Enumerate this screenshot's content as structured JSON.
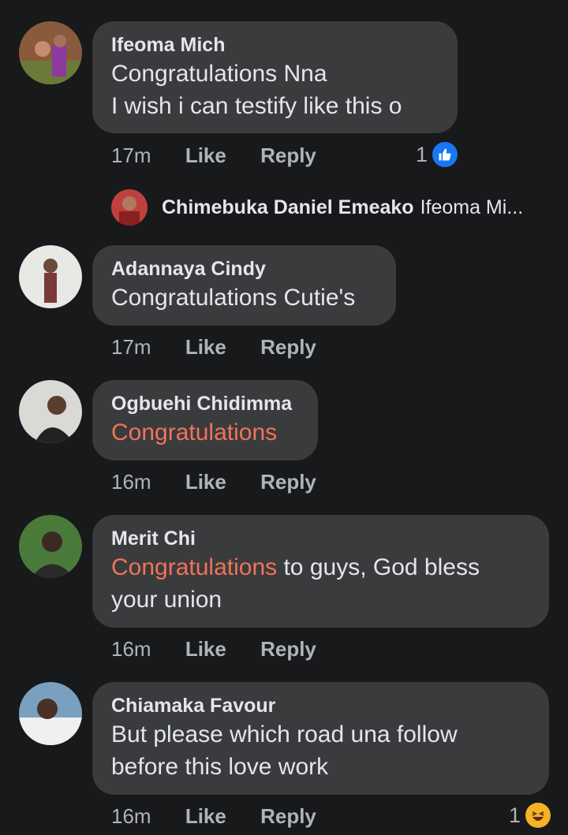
{
  "thread": {
    "comments": [
      {
        "name": "Ifeoma Mich",
        "lines": [
          "Congratulations Nna",
          "I wish i can testify like this o"
        ],
        "time": "17m",
        "like": "Like",
        "reply": "Reply",
        "reaction_count": "1",
        "reaction_icon": "like-icon"
      },
      {
        "name": "Adannaya Cindy",
        "lines": [
          "Congratulations Cutie's"
        ],
        "time": "17m",
        "like": "Like",
        "reply": "Reply"
      },
      {
        "name": "Ogbuehi Chidimma",
        "highlight": "Congratulations",
        "time": "16m",
        "like": "Like",
        "reply": "Reply"
      },
      {
        "name": "Merit Chi",
        "highlight": "Congratulations",
        "rest": " to guys, God bless",
        "line2": "your union",
        "time": "16m",
        "like": "Like",
        "reply": "Reply"
      },
      {
        "name": "Chiamaka Favour",
        "lines": [
          "But please which road una follow",
          "before this love work"
        ],
        "time": "16m",
        "like": "Like",
        "reply": "Reply",
        "reaction_count": "1",
        "reaction_icon": "haha-icon"
      }
    ],
    "reply_preview": {
      "name": "Chimebuka Daniel Emeako",
      "text": "Ifeoma Mi..."
    }
  },
  "colors": {
    "background": "#18191a",
    "bubble": "#3a3b3c",
    "highlight": "#f0735a",
    "meta": "#b0b3b8",
    "like_blue": "#1877f2",
    "haha_yellow": "#f7b125"
  }
}
